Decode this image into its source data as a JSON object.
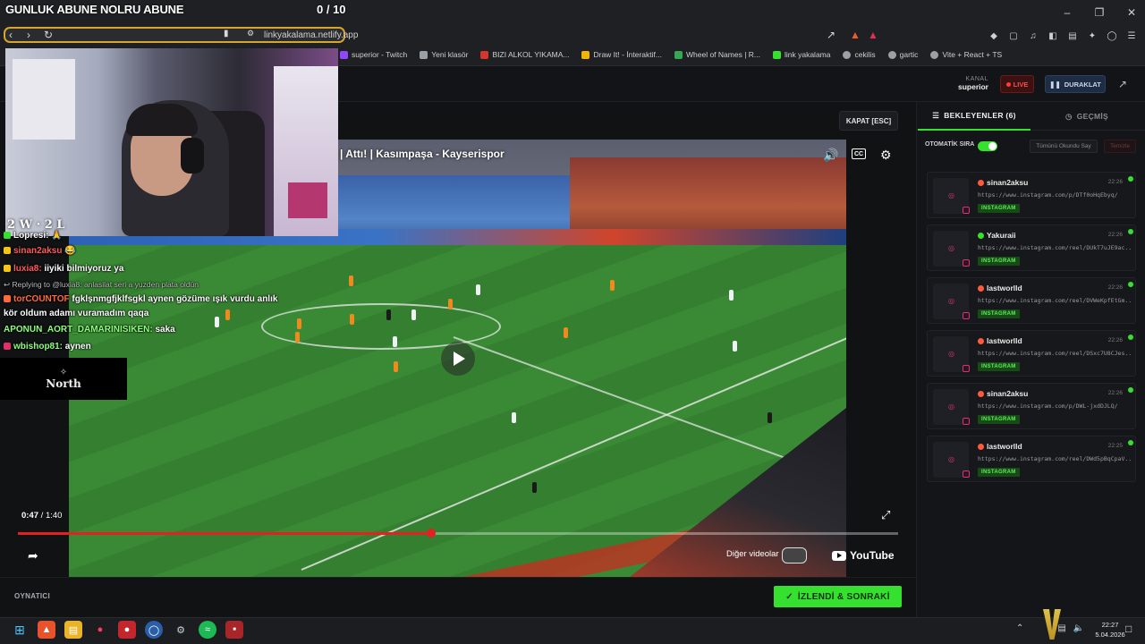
{
  "overlay": {
    "title": "GUNLUK ABUNE NOLRU ABUNE",
    "goal": "0 / 10",
    "wl": "2 W · 2 L"
  },
  "browser": {
    "url": "linkyakalama.netlify.app",
    "bookmarks": [
      {
        "label": "superior - Twitch",
        "color": "#9147ff"
      },
      {
        "label": "Yeni klasör",
        "color": "#9aa0a6"
      },
      {
        "label": "BIZI ALKOL YIKAMA...",
        "color": "#d6372d"
      },
      {
        "label": "Draw It! - İnteraktif...",
        "color": "#f2b400"
      },
      {
        "label": "Wheel of Names | R...",
        "color": "#34a853"
      },
      {
        "label": "link yakalama",
        "color": "#35e02f"
      },
      {
        "label": "cekilis",
        "color": "#9aa0a6"
      },
      {
        "label": "gartic",
        "color": "#9aa0a6"
      },
      {
        "label": "Vite + React + TS",
        "color": "#9aa0a6"
      }
    ]
  },
  "header": {
    "kanal_label": "KANAL",
    "kanal_value": "superior",
    "live_label": "LIVE",
    "pause_label": "DURAKLAT"
  },
  "player": {
    "close_label": "KAPAT [ESC]",
    "video_title": "| Attı! | Kasımpaşa - Kayserispor",
    "current_time": "0:47",
    "duration": "1:40",
    "progress": 0.47,
    "more_videos_label": "Diğer videolar",
    "youtube_label": "YouTube",
    "section_label": "OYNATICI",
    "next_label": "İZLENDİ & SONRAKİ"
  },
  "chat": [
    {
      "user": "Lopresi:",
      "text": "🙏",
      "color": "#ffffff"
    },
    {
      "user": "sinan2aksu",
      "text": "😂",
      "color": "#ff5a5a"
    },
    {
      "user": "luxia8:",
      "text": "iiyiki bilmiyoruz ya",
      "color": "#ff5a5a"
    },
    {
      "user": "",
      "text": "Replying to @luxia8: anlasilat seri a yuzden plata oldün",
      "color": "#bbbbbb"
    },
    {
      "user": "torCOUNTOF",
      "text": "fgklşnmgfjklfsgkl aynen gözüme ışık vurdu anlık",
      "color": "#ff6a3d"
    },
    {
      "user": "",
      "text": "kör oldum adamı vuramadım qaqa",
      "color": "#ffffff"
    },
    {
      "user": "APONUN_AORT_DAMARINISIKEN:",
      "text": "saka",
      "color": "#8cff7a"
    },
    {
      "user": "wbishop81:",
      "text": "aynen",
      "color": "#8cff7a"
    }
  ],
  "north": {
    "label": "North"
  },
  "queue": {
    "tab_active": "BEKLEYENLER (6)",
    "tab_inactive": "GEÇMİŞ",
    "auto_label": "OTOMATİK SIRA",
    "mark_all_label": "Tümünü Okundu Say",
    "clear_label": "Temizle",
    "items": [
      {
        "user": "sinan2aksu",
        "time": "22:26",
        "url": "https://www.instagram.com/p/DTf0oHqEbyq/",
        "tag": "INSTAGRAM",
        "dot_color": "#ff5a3d"
      },
      {
        "user": "Yakuraii",
        "time": "22:26",
        "url": "https://www.instagram.com/reel/DUkT7uJE9ac...",
        "tag": "INSTAGRAM",
        "dot_color": "#35e02f"
      },
      {
        "user": "lastworlld",
        "time": "22:26",
        "url": "https://www.instagram.com/reel/DVWeKpfEtGm...",
        "tag": "INSTAGRAM",
        "dot_color": "#ff5a3d"
      },
      {
        "user": "lastworlld",
        "time": "22:26",
        "url": "https://www.instagram.com/reel/DSxc7U8CJes...",
        "tag": "INSTAGRAM",
        "dot_color": "#ff5a3d"
      },
      {
        "user": "sinan2aksu",
        "time": "22:26",
        "url": "https://www.instagram.com/p/DWL-jxdDJLQ/",
        "tag": "INSTAGRAM",
        "dot_color": "#ff5a3d"
      },
      {
        "user": "lastworlld",
        "time": "22:25",
        "url": "https://www.instagram.com/reel/DWd5pBqCpaV...",
        "tag": "INSTAGRAM",
        "dot_color": "#ff5a3d"
      }
    ]
  },
  "taskbar": {
    "time": "22:27",
    "date": "5.04.2026"
  }
}
